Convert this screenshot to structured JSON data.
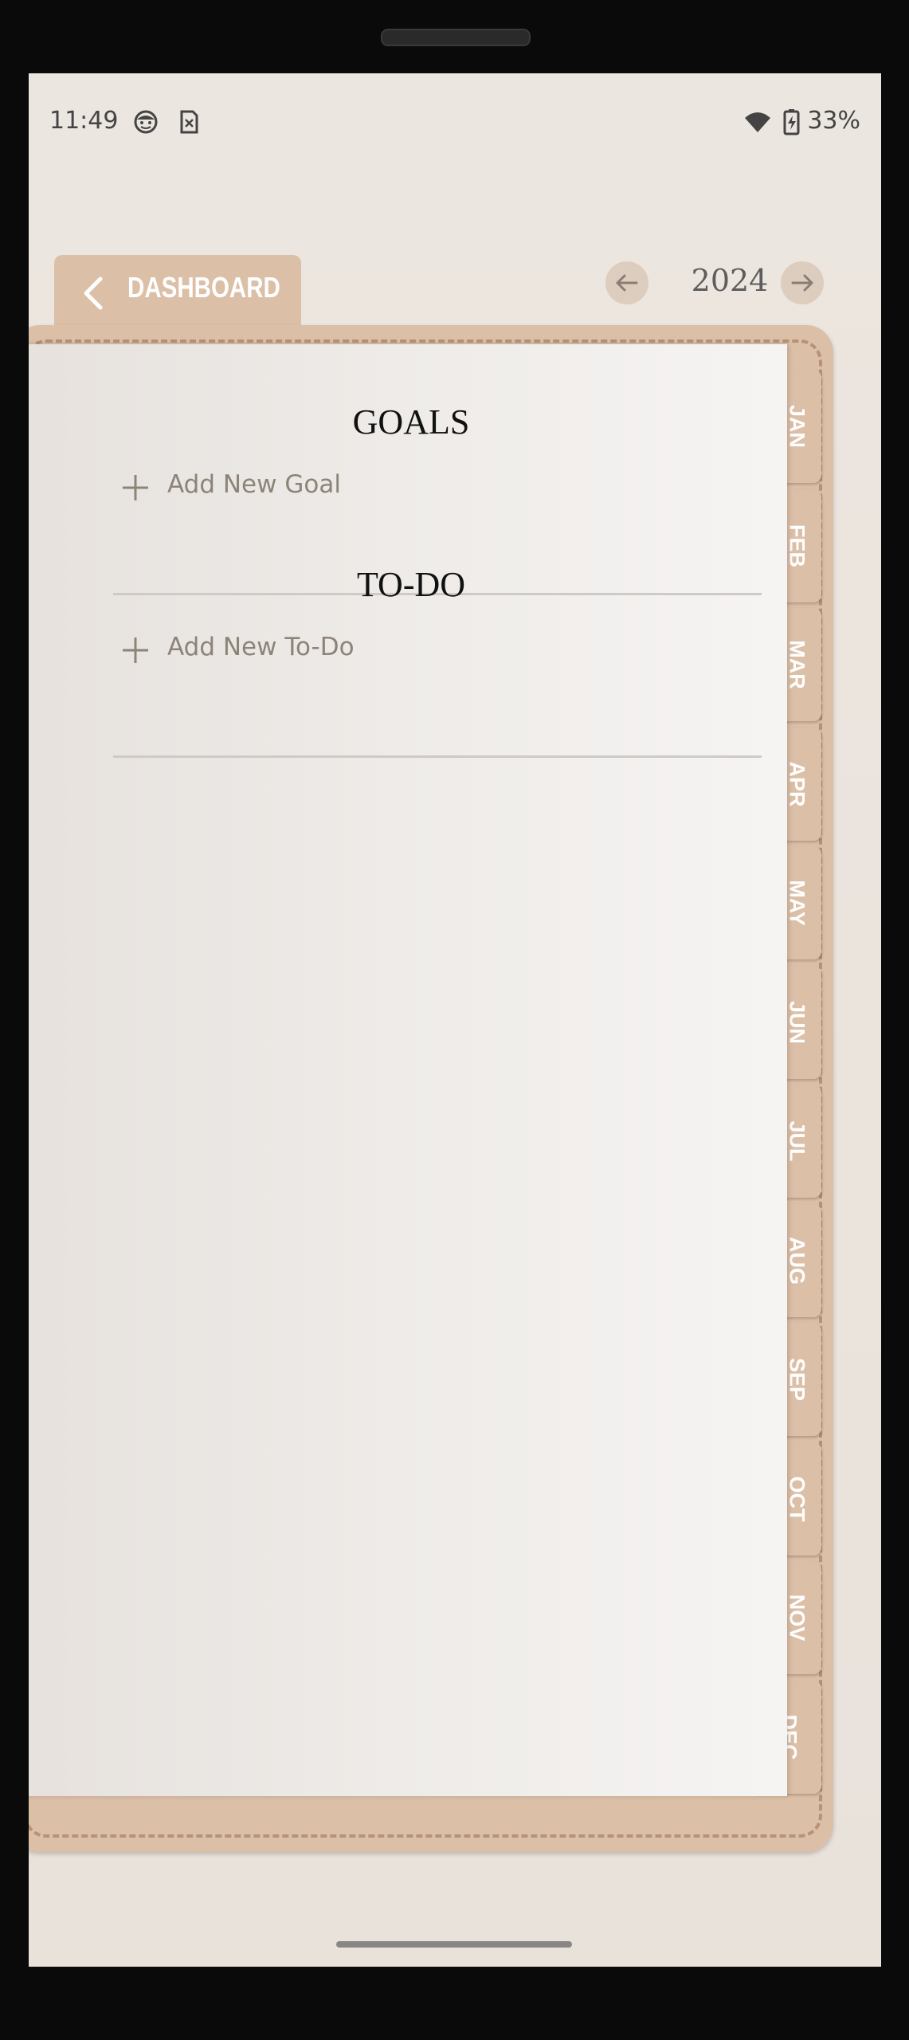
{
  "status_bar": {
    "time": "11:49",
    "battery": "33%",
    "icons": [
      "smiley-icon",
      "sim-off-icon",
      "wifi-icon",
      "battery-charging-icon"
    ]
  },
  "header": {
    "back_label": "DASHBOARD",
    "year": "2024"
  },
  "goals": {
    "title": "GOALS",
    "add_label": "Add New Goal"
  },
  "todo": {
    "title": "TO-DO",
    "add_label": "Add New To-Do"
  },
  "months": [
    "JAN",
    "FEB",
    "MAR",
    "APR",
    "MAY",
    "JUN",
    "JUL",
    "AUG",
    "SEP",
    "OCT",
    "NOV",
    "DEC"
  ],
  "active_month": "DEC",
  "colors": {
    "leather": "#dcbfa7",
    "background": "#ece6e0",
    "text_muted": "#8d8478"
  }
}
